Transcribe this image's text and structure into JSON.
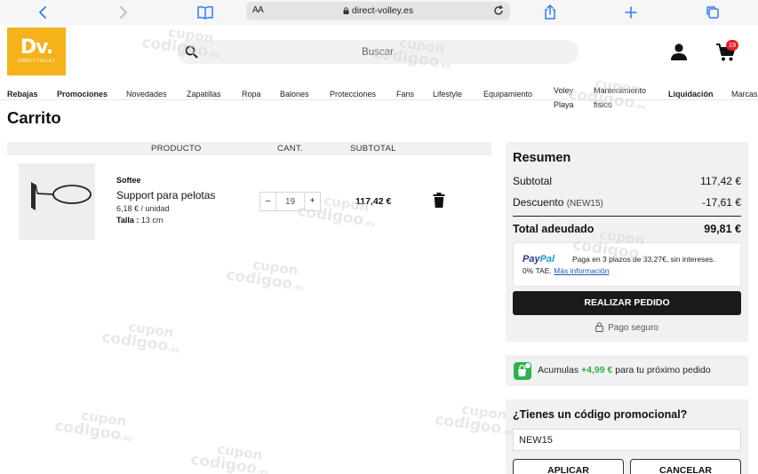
{
  "browser": {
    "url": "direct-volley.es",
    "aa_label": "AA"
  },
  "header": {
    "logo_main": "Dv.",
    "logo_sub": "DIRECT VOLLEY",
    "search_placeholder": "Buscar",
    "cart_count": "19"
  },
  "nav": {
    "items": [
      "Rebajas",
      "Promociones",
      "Novedades",
      "Zapatillas",
      "Ropa",
      "Balones",
      "Protecciones",
      "Fans",
      "Lifestyle",
      "Equipamiento",
      "Voley Playa",
      "Mantenimiento físico",
      "Liquidación",
      "Marcas"
    ]
  },
  "page": {
    "title": "Carrito"
  },
  "cart": {
    "columns": [
      "PRODUCTO",
      "CANT.",
      "SUBTOTAL"
    ],
    "item": {
      "brand": "Softee",
      "name": "Support para pelotas",
      "unit_price": "6,18 € / unidad",
      "size_label": "Talla :",
      "size_value": "13 cm",
      "quantity": "19",
      "minus": "–",
      "plus": "+",
      "line_total": "117,42 €"
    }
  },
  "summary": {
    "title": "Resumen",
    "subtotal_label": "Subtotal",
    "subtotal_value": "117,42 €",
    "discount_label": "Descuento",
    "discount_code": "(NEW15)",
    "discount_value": "-17,61 €",
    "total_label": "Total adeudado",
    "total_value": "99,81 €",
    "paypal_pay": "Pay",
    "paypal_pal": "Pal",
    "paypal_text1": "Paga en 3 plazos de 33,27€, sin intereses.",
    "paypal_text2": "0% TAE.",
    "paypal_link": "Más información",
    "order_button": "REALIZAR PEDIDO",
    "secure_label": "Pago seguro"
  },
  "loyalty": {
    "prefix": "Acumulas",
    "points": "+4,99 €",
    "suffix": "para tu próximo pedido"
  },
  "promo": {
    "title": "¿Tienes un código promocional?",
    "value": "NEW15",
    "apply": "APLICAR",
    "cancel": "CANCELAR"
  },
  "watermark": {
    "line1": "cupon",
    "line2": "codigoo",
    "line3": ".es"
  },
  "colors": {
    "brand_yellow": "#f5b21a",
    "badge_red": "#e3202a",
    "points_green": "#2bb24c",
    "paypal_dark": "#253b80",
    "paypal_light": "#179bd7"
  }
}
